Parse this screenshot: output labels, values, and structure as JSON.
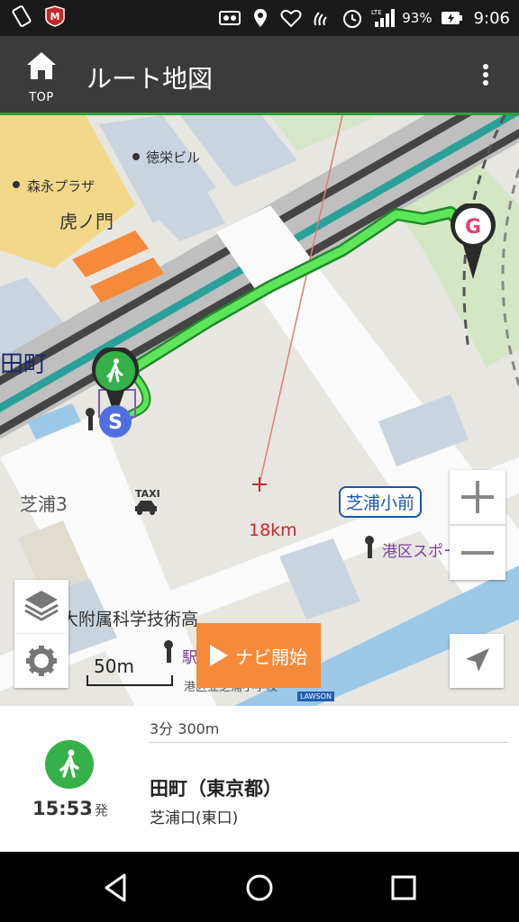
{
  "status_bar": {
    "battery": "93%",
    "time": "9:06",
    "network": "LTE"
  },
  "app_bar": {
    "home_label": "TOP",
    "title": "ルート地図"
  },
  "map": {
    "labels": {
      "tokuei": "徳栄ビル",
      "morinaga": "森永プラザ",
      "toranomon": "虎ノ門",
      "tamachi": "田町",
      "shibaura3": "芝浦3",
      "taxi": "TAXI",
      "shibaura_sho": "芝浦小前",
      "sports_center": "港区スポーツセン",
      "fuzoku": "大附属科学技術高",
      "eki": "駅",
      "minato_school": "港区立芝浦小学校",
      "lawson": "LAWSON",
      "distance": "18km",
      "goal_marker": "G",
      "start_station_marker": "S"
    },
    "scale_label": "50m",
    "navi_label": "ナビ開始"
  },
  "route_panel": {
    "duration": "3分 300m",
    "departure_time": "15:53",
    "departure_suffix": "発",
    "station": "田町（東京都）",
    "exit": "芝浦口(東口)"
  },
  "colors": {
    "route": "#5ee65a",
    "route_border": "#1f8a2a",
    "walk_green": "#35b14a",
    "navi_orange": "#f58a3a",
    "appbar": "#3b3b3b",
    "goal_pink": "#e0427a"
  }
}
